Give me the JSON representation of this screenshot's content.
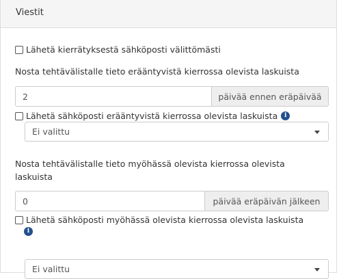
{
  "panel": {
    "title": "Viestit"
  },
  "send_email_immediately": {
    "checked": false,
    "label": "Lähetä kierrätyksestä sähköposti välittömästi"
  },
  "overdue_task": {
    "label": "Nosta tehtävälistalle tieto erääntyvistä kierrossa olevista laskuista",
    "value": "2",
    "unit": "päivää ennen eräpäivää"
  },
  "overdue_email": {
    "checked": false,
    "label": "Lähetä sähköposti erääntyvistä kierrossa olevista laskuista",
    "info_icon": "info-circle-icon",
    "select_value": "Ei valittu"
  },
  "late_task": {
    "label_line1": "Nosta tehtävälistalle tieto myöhässä olevista kierrossa olevista",
    "label_line2": "laskuista",
    "value": "0",
    "unit": "päivää eräpäivän jälkeen"
  },
  "late_email": {
    "checked": false,
    "label": "Lähetä sähköposti myöhässä olevista kierrossa olevista laskuista",
    "info_icon": "info-circle-icon",
    "select_value": "Ei valittu"
  },
  "colors": {
    "info_icon": "#23508e",
    "addon_bg": "#eeeeee",
    "heading_bg": "#f5f5f5"
  }
}
